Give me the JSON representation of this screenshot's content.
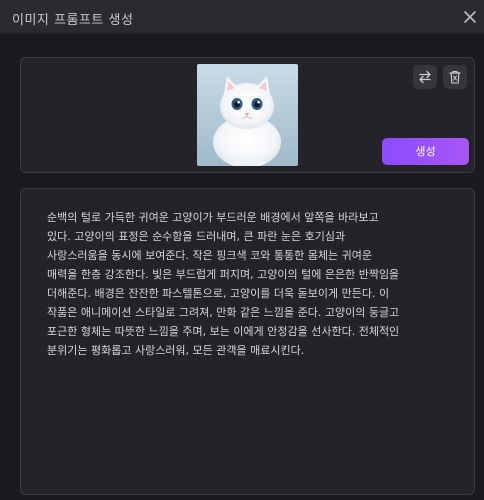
{
  "window": {
    "title": "이미지 프롬프트 생성"
  },
  "image_panel": {
    "swap_icon": "swap-icon",
    "delete_icon": "trash-icon",
    "generate_label": "생성",
    "accent_gradient": [
      "#8a4cff",
      "#a855f7"
    ]
  },
  "prompt": {
    "text": "순백의 털로 가득한 귀여운 고양이가 부드러운 배경에서 앞쪽을 바라보고\n있다. 고양이의 표정은 순수함을 드러내며, 큰 파란 눈은 호기심과\n사랑스러움을 동시에 보여준다. 작은 핑크색 코와 통통한 몸체는 귀여운\n매력을 한층 강조한다. 빛은 부드럽게 퍼지며, 고양이의 털에 은은한 반짝임을\n더해준다. 배경은 잔잔한 파스텔톤으로, 고양이를 더욱 돋보이게 만든다. 이\n작품은 애니메이션 스타일로 그려져, 만화 같은 느낌을 준다. 고양이의 둥글고\n포근한 형체는 따뜻한 느낌을 주며, 보는 이에게 안정감을 선사한다. 전체적인\n분위기는 평화롭고 사랑스러워, 모든 관객을 매료시킨다."
  }
}
